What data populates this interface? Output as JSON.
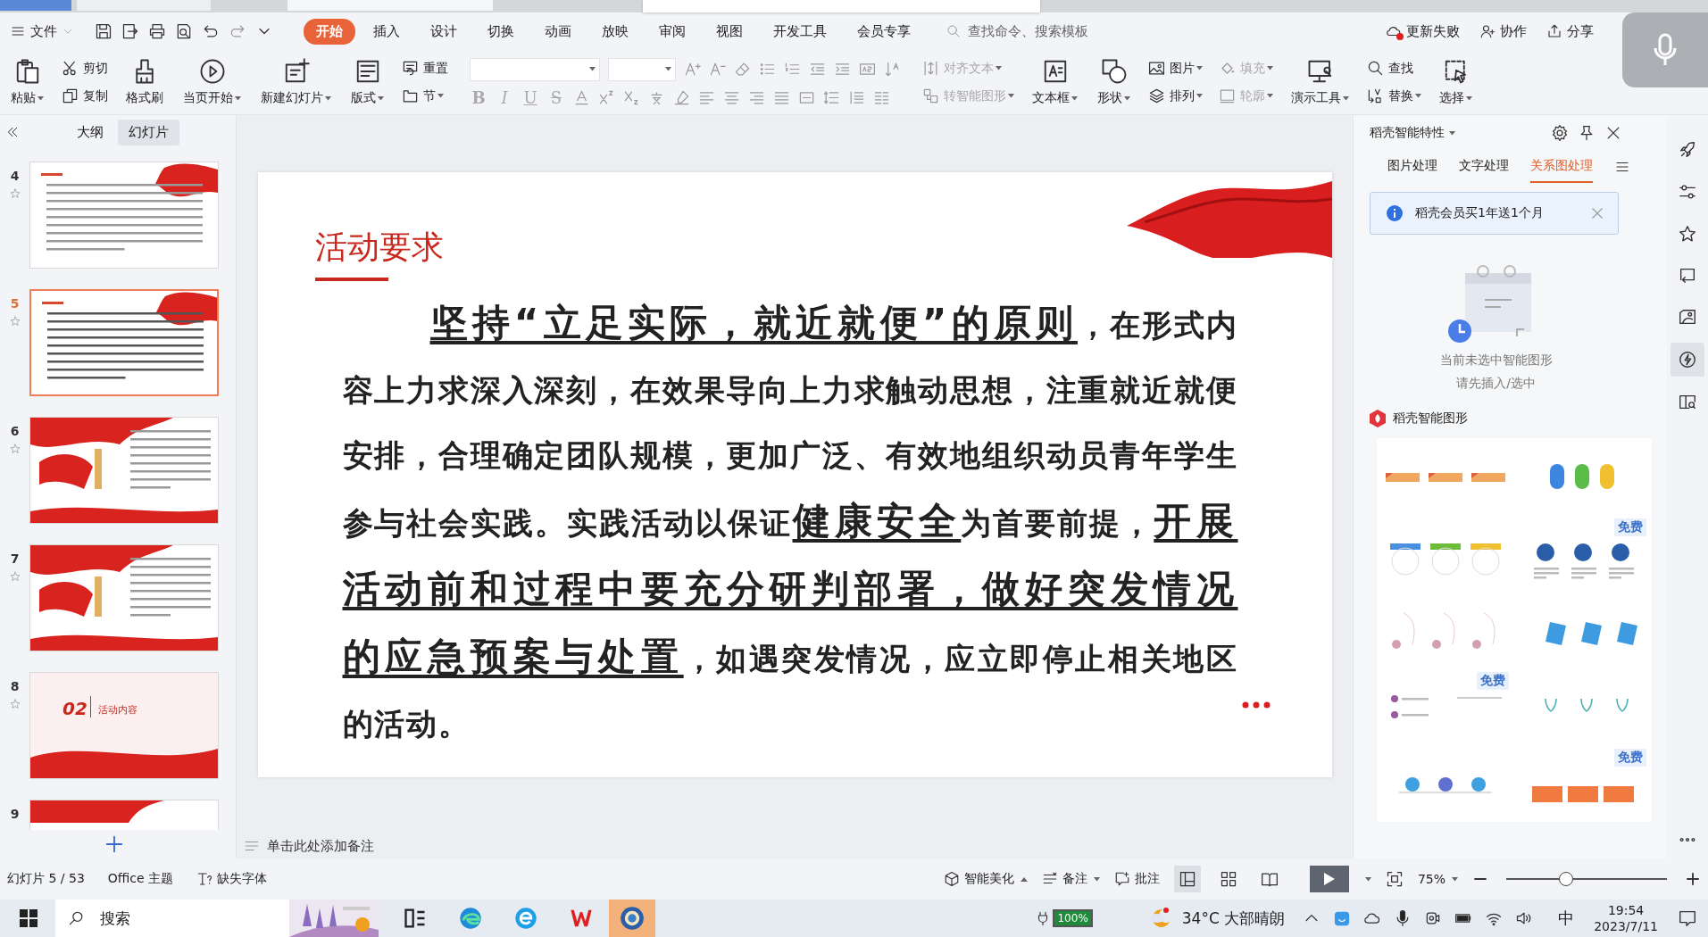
{
  "menu": {
    "file_label": "文件",
    "tabs": [
      {
        "label": "开始",
        "selected": true
      },
      {
        "label": "插入",
        "selected": false
      },
      {
        "label": "设计",
        "selected": false
      },
      {
        "label": "切换",
        "selected": false
      },
      {
        "label": "动画",
        "selected": false
      },
      {
        "label": "放映",
        "selected": false
      },
      {
        "label": "审阅",
        "selected": false
      },
      {
        "label": "视图",
        "selected": false
      },
      {
        "label": "开发工具",
        "selected": false
      },
      {
        "label": "会员专享",
        "selected": false
      }
    ],
    "search": {
      "placeholder": "查找命令、搜索模板"
    },
    "actions": [
      "更新失败",
      "协作",
      "分享"
    ]
  },
  "ribbon": [
    {
      "kind": "large",
      "label": "粘贴",
      "caret": true,
      "disabled": false
    },
    {
      "kind": "stack",
      "items": [
        {
          "label": "剪切",
          "caret": false,
          "disabled": false
        },
        {
          "label": "复制",
          "caret": false,
          "disabled": false
        }
      ]
    },
    {
      "kind": "large",
      "label": "格式刷",
      "caret": false,
      "disabled": false
    },
    {
      "kind": "large",
      "label": "当页开始",
      "caret": true,
      "disabled": false
    },
    {
      "kind": "large",
      "label": "新建幻灯片",
      "caret": true,
      "disabled": false
    },
    {
      "kind": "large",
      "label": "版式",
      "caret": true,
      "disabled": false
    },
    {
      "kind": "stack",
      "items": [
        {
          "label": "重置",
          "caret": false,
          "disabled": false
        },
        {
          "label": "节",
          "caret": true,
          "disabled": false
        }
      ]
    },
    {
      "kind": "font",
      "format_buttons": [
        "B",
        "I",
        "U",
        "S"
      ]
    },
    {
      "kind": "stack",
      "items": [
        {
          "label": "对齐文本",
          "caret": true,
          "disabled": true
        },
        {
          "label": "转智能图形",
          "caret": true,
          "disabled": true
        }
      ]
    },
    {
      "kind": "large",
      "label": "文本框",
      "caret": true,
      "disabled": false
    },
    {
      "kind": "large",
      "label": "形状",
      "caret": true,
      "disabled": false
    },
    {
      "kind": "stack",
      "items": [
        {
          "label": "图片",
          "caret": true,
          "disabled": false
        },
        {
          "label": "排列",
          "caret": true,
          "disabled": false
        }
      ]
    },
    {
      "kind": "stack",
      "items": [
        {
          "label": "填充",
          "caret": true,
          "disabled": true
        },
        {
          "label": "轮廓",
          "caret": true,
          "disabled": true
        }
      ]
    },
    {
      "kind": "large",
      "label": "演示工具",
      "caret": true,
      "disabled": false
    },
    {
      "kind": "stack",
      "items": [
        {
          "label": "查找",
          "caret": false,
          "disabled": false
        },
        {
          "label": "替换",
          "caret": true,
          "disabled": false
        }
      ]
    },
    {
      "kind": "large",
      "label": "选择",
      "caret": true,
      "disabled": false
    }
  ],
  "left_panel": {
    "tabs": [
      {
        "label": "大纲",
        "selected": false
      },
      {
        "label": "幻灯片",
        "selected": true
      }
    ],
    "slides": [
      {
        "number": "4",
        "starred": true,
        "selected": false,
        "kind": "text"
      },
      {
        "number": "5",
        "starred": true,
        "selected": true,
        "kind": "text"
      },
      {
        "number": "6",
        "starred": true,
        "selected": false,
        "kind": "flag"
      },
      {
        "number": "7",
        "starred": true,
        "selected": false,
        "kind": "flag"
      },
      {
        "number": "8",
        "starred": true,
        "selected": false,
        "kind": "section",
        "part": "02",
        "heading": "活动内容"
      },
      {
        "number": "9",
        "starred": false,
        "selected": false,
        "kind": "header"
      }
    ]
  },
  "slide": {
    "title": "活动要求",
    "body": "**坚持“立足实际，就近就便”的原则**，在形式内容上力求深入深刻，在效果导向上力求触动思想，注重就近就便安排，合理确定团队规模，更加广泛、有效地组织动员青年学生参与社会实践。实践活动以保证**健康安全**为首要前提，**开展活动前和过程中要充分研判部署，做好突发情况的应急预案与处置**，如遇突发情况，应立即停止相关地区的活动。"
  },
  "notes": {
    "placeholder": "单击此处添加备注"
  },
  "panel": {
    "title": "稻壳智能特性",
    "tabs": [
      {
        "label": "图片处理",
        "selected": false
      },
      {
        "label": "文字处理",
        "selected": false
      },
      {
        "label": "关系图处理",
        "selected": true
      }
    ],
    "banner": "稻壳会员买1年送1个月",
    "empty_lines": [
      "当前未选中智能图形",
      "请先插入/选中"
    ],
    "section_title": "稻壳智能图形",
    "templates": [
      {
        "kind": "tabs"
      },
      {
        "kind": "pills"
      },
      {
        "kind": "cups"
      },
      {
        "kind": "circles",
        "badge": "免费"
      },
      {
        "kind": "hooks"
      },
      {
        "kind": "notes"
      },
      {
        "kind": "timeline",
        "badge": "免费"
      },
      {
        "kind": "pendants"
      },
      {
        "kind": "bubbles"
      },
      {
        "kind": "boxes",
        "badge": "免费"
      }
    ]
  },
  "side_tools": [
    {
      "selected": false
    },
    {
      "selected": false
    },
    {
      "selected": false
    },
    {
      "selected": false
    },
    {
      "selected": false
    },
    {
      "selected": true
    },
    {
      "selected": false
    }
  ],
  "status_bar": {
    "slide_info": "幻灯片 5 / 53",
    "theme": "Office 主题",
    "missing_fonts": "缺失字体",
    "beautify": "智能美化",
    "notes": "备注",
    "comments": "批注",
    "views": [
      {
        "selected": true
      },
      {
        "selected": false
      },
      {
        "selected": false
      }
    ],
    "zoom": "75%",
    "zoom_slider": {
      "level": 0.37
    }
  },
  "taskbar": {
    "search": {
      "placeholder": "搜索"
    },
    "apps": [
      {
        "selected": false
      },
      {
        "selected": false
      },
      {
        "selected": false
      },
      {
        "selected": false
      },
      {
        "selected": true
      }
    ],
    "battery": "100%",
    "weather": "34°C 大部晴朗",
    "ime": "中",
    "time": "19:54",
    "date": "2023/7/11"
  }
}
